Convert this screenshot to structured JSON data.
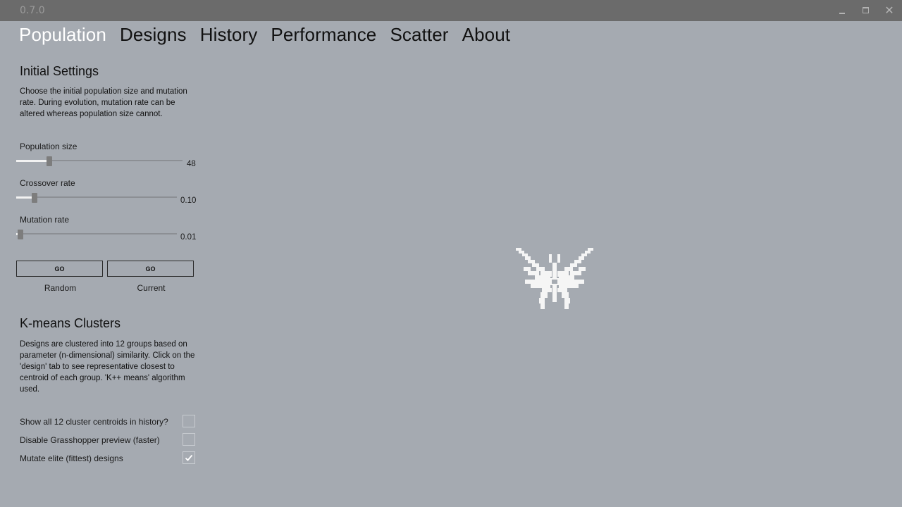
{
  "window": {
    "version": "0.7.0"
  },
  "nav": {
    "tabs": [
      {
        "label": "Population",
        "active": true
      },
      {
        "label": "Designs"
      },
      {
        "label": "History"
      },
      {
        "label": "Performance"
      },
      {
        "label": "Scatter"
      },
      {
        "label": "About"
      }
    ]
  },
  "initial_settings": {
    "heading": "Initial Settings",
    "description": "Choose the initial population size and mutation rate. During evolution, mutation rate can be altered whereas population size cannot.",
    "population_size": {
      "label": "Population size",
      "value": "48",
      "fraction": 0.2
    },
    "crossover_rate": {
      "label": "Crossover rate",
      "value": "0.10",
      "fraction": 0.1
    },
    "mutation_rate": {
      "label": "Mutation rate",
      "value": "0.01",
      "fraction": 0.01
    },
    "buttons": [
      {
        "label": "GO",
        "caption": "Random"
      },
      {
        "label": "GO",
        "caption": "Current"
      }
    ]
  },
  "kmeans": {
    "heading": "K-means Clusters",
    "description": "Designs are clustered into 12 groups based on parameter (n-dimensional) similarity. Click on the 'design' tab to see representative closest to centroid of each group. 'K++ means' algorithm used."
  },
  "options": [
    {
      "label": "Show all 12 cluster centroids in history?",
      "checked": false
    },
    {
      "label": "Disable Grasshopper preview (faster)",
      "checked": false
    },
    {
      "label": "Mutate elite (fittest) designs",
      "checked": true
    }
  ],
  "colors": {
    "active_tab": "#ffffff",
    "background": "#a5aab1",
    "titlebar": "#6b6b6b"
  },
  "icons": {
    "logo": "butterfly-logo-icon"
  }
}
